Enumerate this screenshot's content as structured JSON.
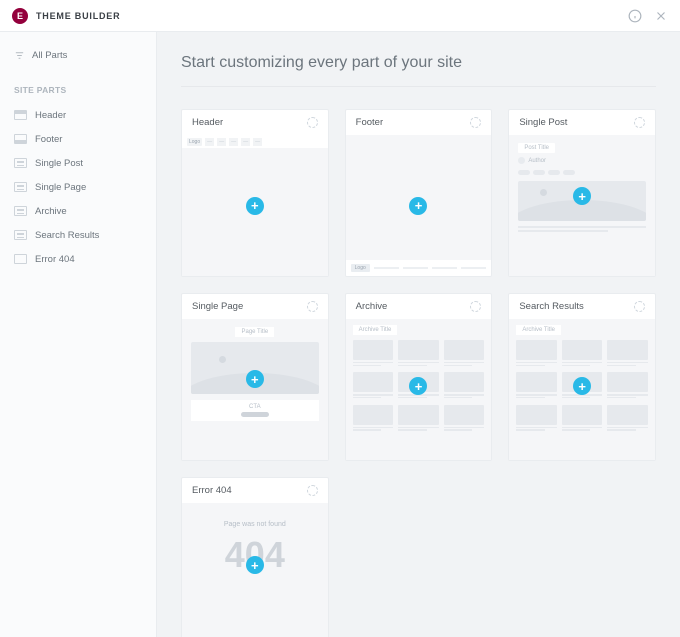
{
  "topbar": {
    "title": "THEME BUILDER"
  },
  "sidebar": {
    "all_parts": "All Parts",
    "section_label": "SITE PARTS",
    "items": [
      {
        "label": "Header"
      },
      {
        "label": "Footer"
      },
      {
        "label": "Single Post"
      },
      {
        "label": "Single Page"
      },
      {
        "label": "Archive"
      },
      {
        "label": "Search Results"
      },
      {
        "label": "Error 404"
      }
    ]
  },
  "main": {
    "heading": "Start customizing every part of your site",
    "cards": {
      "header": {
        "title": "Header",
        "logo": "Logo"
      },
      "footer": {
        "title": "Footer",
        "logo": "Logo"
      },
      "single_post": {
        "title": "Single Post",
        "post_title": "Post Title",
        "author": "Author"
      },
      "single_page": {
        "title": "Single Page",
        "page_title": "Page Title",
        "cta": "CTA"
      },
      "archive": {
        "title": "Archive",
        "archive_title": "Archive Title"
      },
      "search_results": {
        "title": "Search Results",
        "archive_title": "Archive Title"
      },
      "error_404": {
        "title": "Error 404",
        "message": "Page was not found",
        "code": "404"
      }
    }
  }
}
